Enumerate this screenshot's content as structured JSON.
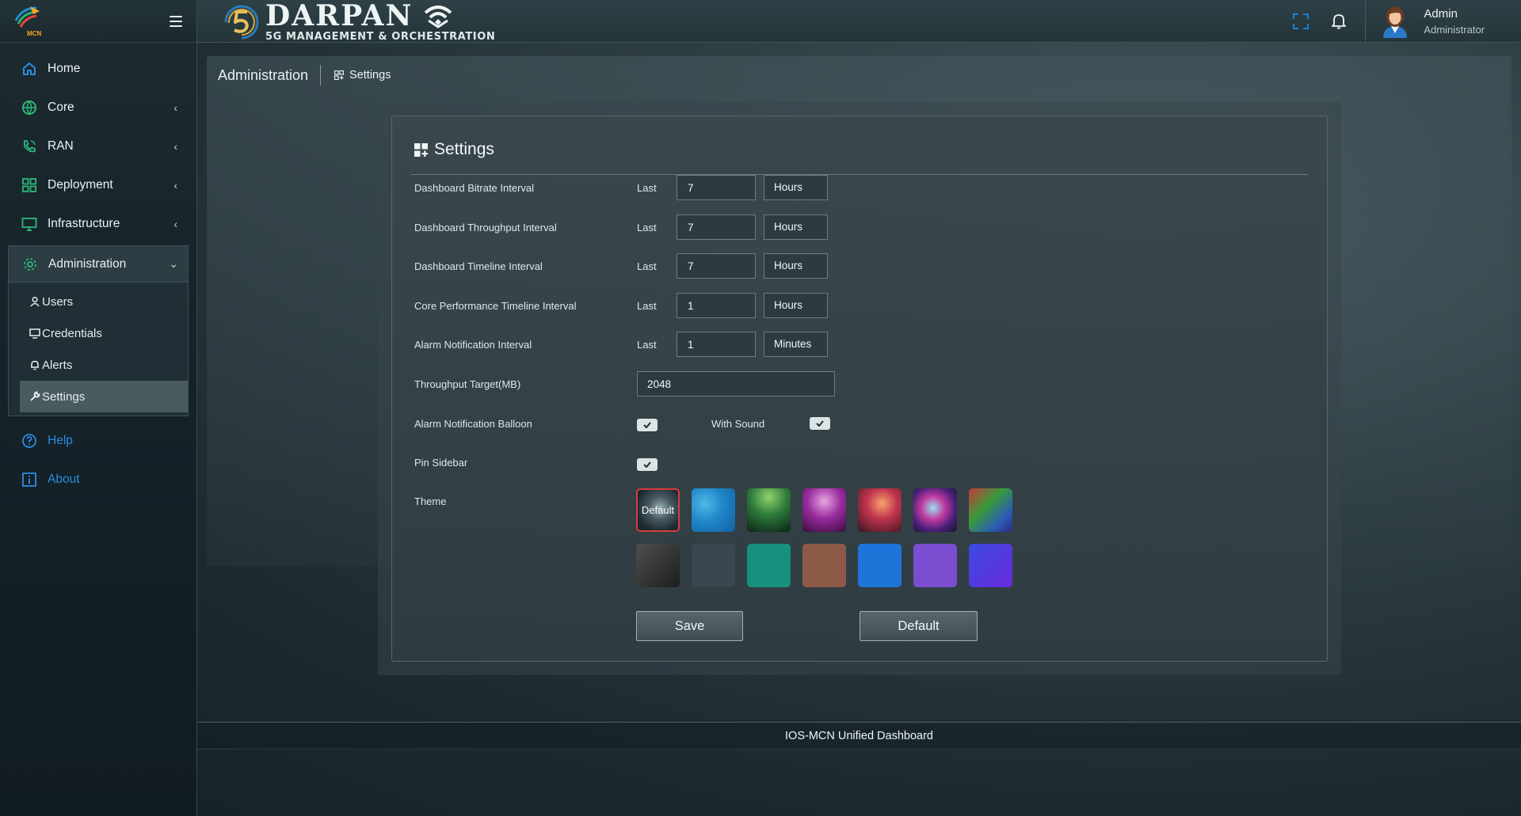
{
  "sidebar": {
    "logo_text": "MCN",
    "items": [
      {
        "label": "Home",
        "icon": "home-icon"
      },
      {
        "label": "Core",
        "icon": "globe-icon"
      },
      {
        "label": "RAN",
        "icon": "phone-icon"
      },
      {
        "label": "Deployment",
        "icon": "grid-icon"
      },
      {
        "label": "Infrastructure",
        "icon": "monitor-icon"
      },
      {
        "label": "Administration",
        "icon": "gear-icon"
      }
    ],
    "sub_items": [
      {
        "label": "Users",
        "icon": "user-icon"
      },
      {
        "label": "Credentials",
        "icon": "monitor-icon"
      },
      {
        "label": "Alerts",
        "icon": "bell-icon"
      },
      {
        "label": "Settings",
        "icon": "wrench-icon"
      }
    ],
    "links": [
      {
        "label": "Help",
        "icon": "help-icon"
      },
      {
        "label": "About",
        "icon": "info-icon"
      }
    ]
  },
  "header": {
    "brand_name": "DARPAN",
    "brand_sub": "5G MANAGEMENT & ORCHESTRATION",
    "user_name": "Admin",
    "user_role": "Administrator"
  },
  "breadcrumb": {
    "root": "Administration",
    "current": "Settings"
  },
  "settings": {
    "title": "Settings",
    "last_label": "Last",
    "rows": [
      {
        "label": "Dashboard Bitrate Interval",
        "value": "7",
        "unit": "Hours"
      },
      {
        "label": "Dashboard Throughput Interval",
        "value": "7",
        "unit": "Hours"
      },
      {
        "label": "Dashboard Timeline Interval",
        "value": "7",
        "unit": "Hours"
      },
      {
        "label": "Core Performance Timeline Interval",
        "value": "1",
        "unit": "Hours"
      },
      {
        "label": "Alarm Notification Interval",
        "value": "1",
        "unit": "Minutes"
      }
    ],
    "throughput_label": "Throughput Target(MB)",
    "throughput_value": "2048",
    "balloon_label": "Alarm Notification Balloon",
    "balloon_checked": true,
    "with_sound_label": "With Sound",
    "with_sound_checked": true,
    "pin_sidebar_label": "Pin Sidebar",
    "pin_sidebar_checked": true,
    "theme_label": "Theme",
    "theme_default_label": "Default",
    "theme_selected": "Default",
    "save_label": "Save",
    "default_label": "Default"
  },
  "footer": {
    "text": "IOS-MCN Unified Dashboard"
  },
  "colors": {
    "accent_link": "#2b8de0",
    "icon_green": "#2eb87a",
    "selected_theme_border": "#d93b3b"
  }
}
